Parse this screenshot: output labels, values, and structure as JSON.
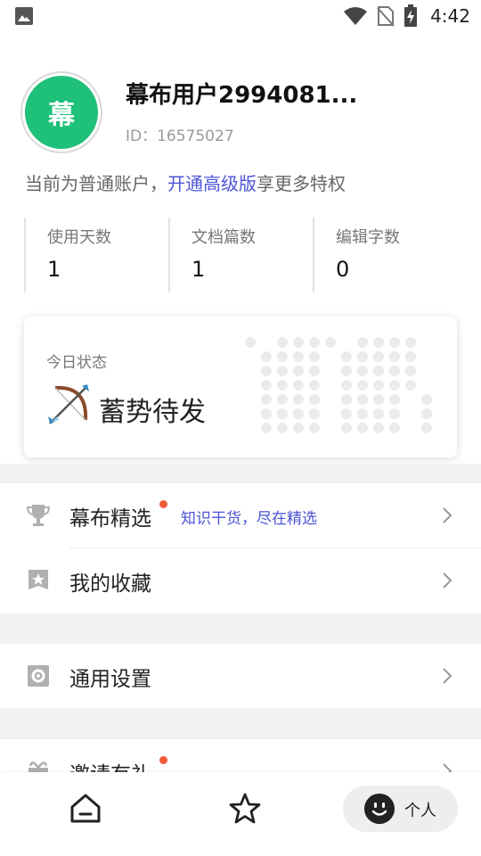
{
  "status_bar": {
    "time": "4:42",
    "icons": [
      "image-icon",
      "wifi-icon",
      "no-sim-icon",
      "battery-charging-icon"
    ]
  },
  "profile": {
    "avatar_text": "幕",
    "avatar_color": "#1fc07a",
    "username": "幕布用户2994081...",
    "user_id": "ID：16575027"
  },
  "account": {
    "prefix": "当前为普通账户，",
    "link": "开通高级版",
    "suffix": "享更多特权",
    "link_color": "#4b54d6"
  },
  "stats": [
    {
      "label": "使用天数",
      "value": "1"
    },
    {
      "label": "文档篇数",
      "value": "1"
    },
    {
      "label": "编辑字数",
      "value": "0"
    }
  ],
  "status_card": {
    "title": "今日状态",
    "status": "蓄势待发",
    "icon": "bow-and-arrow-icon"
  },
  "menu": {
    "featured": {
      "label": "幕布精选",
      "sub": "知识干货，尽在精选",
      "icon": "trophy-icon",
      "has_badge": true
    },
    "favorites": {
      "label": "我的收藏",
      "icon": "star-shield-icon"
    },
    "settings": {
      "label": "通用设置",
      "icon": "gear-icon"
    },
    "invite": {
      "label": "邀请有礼",
      "icon": "gift-icon",
      "has_badge": true
    }
  },
  "bottom_nav": {
    "home_icon": "home-icon",
    "star_icon": "star-icon",
    "personal_label": "个人",
    "personal_icon": "smiley-icon"
  }
}
